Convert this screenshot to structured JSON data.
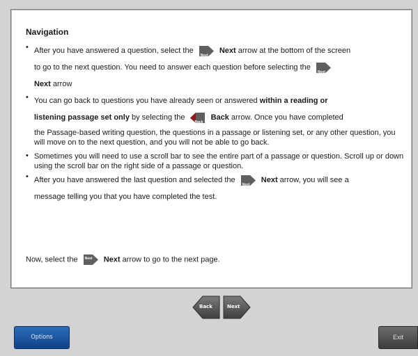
{
  "panel": {
    "heading": "Navigation",
    "bullets": [
      {
        "parts": [
          "After you have answered a question, select the",
          "Next",
          "arrow at the bottom of the screen",
          "to go to the next question. You need to answer each question before selecting the",
          "Next",
          "arrow"
        ]
      },
      {
        "parts": [
          "You can go back to questions you have already seen or answered",
          "within a reading or",
          "listening passage set only",
          "by selecting the",
          "Back",
          "arrow. Once you have completed",
          "the Passage-based writing question, the questions in a passage or listening set, or any other question, you will move on to the next question, and you will not be able to go back."
        ]
      },
      {
        "parts": [
          "Sometimes you will need to use a scroll bar to see the entire part of a passage or question. Scroll up or down using the scroll bar on the right side of a passage or question."
        ]
      },
      {
        "parts": [
          "After you have answered the last question and selected the",
          "Next",
          "arrow, you will see a",
          "message telling you that you have completed the test."
        ]
      }
    ],
    "closing": {
      "before": "Now, select the",
      "bold": "Next",
      "after": "arrow to go to the next page."
    },
    "mini_next_label": "Next",
    "mini_back_label": "Back"
  },
  "footer": {
    "back_label": "Back",
    "next_label": "Next",
    "options_label": "Options",
    "exit_label": "Exit"
  },
  "colors": {
    "arrow_gray": "#5f5f5f",
    "back_accent": "#8b1c1c",
    "options_blue": "#1b56a3"
  },
  "icons": {
    "next": "next-arrow-icon",
    "back": "back-arrow-icon"
  }
}
